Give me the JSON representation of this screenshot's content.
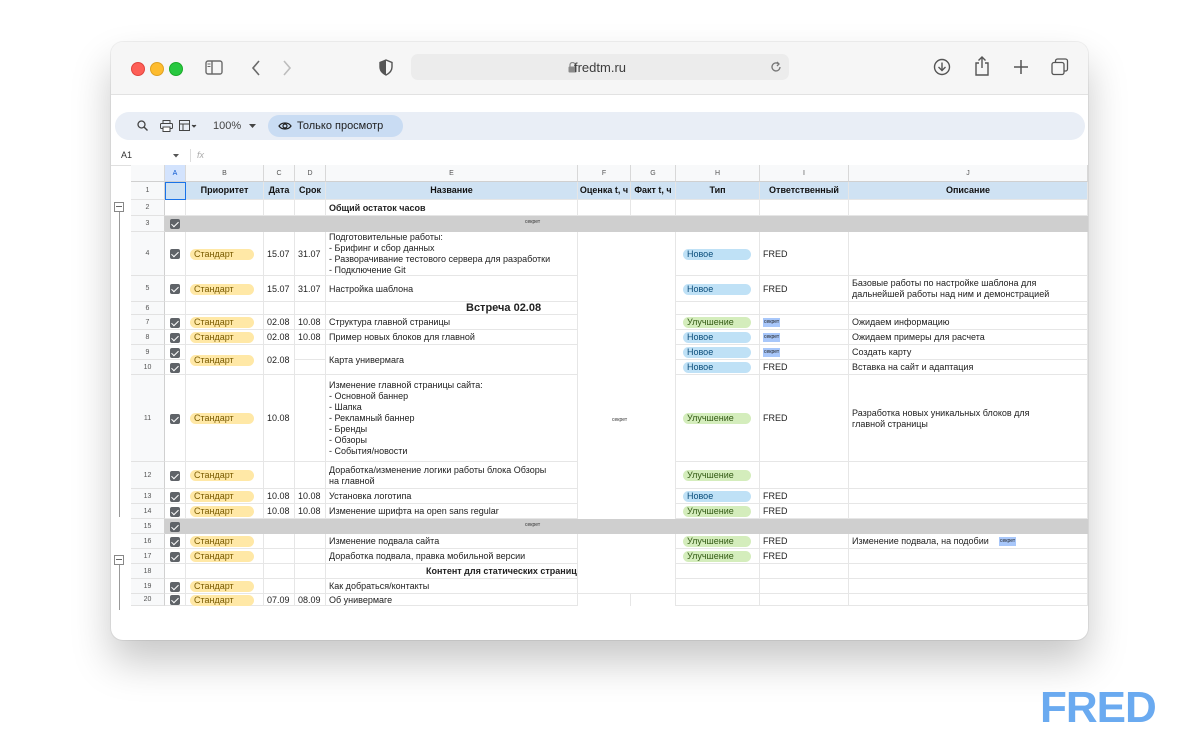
{
  "browser": {
    "url": "fredtm.ru"
  },
  "toolbar": {
    "zoom": "100%",
    "view_only": "Только просмотр"
  },
  "formula_bar": {
    "cell_ref": "A1",
    "fx": "fx"
  },
  "columns": [
    "A",
    "B",
    "C",
    "D",
    "E",
    "F",
    "G",
    "H",
    "I",
    "J"
  ],
  "header_row": {
    "b": "Приоритет",
    "c": "Дата",
    "d": "Срок",
    "e": "Название",
    "f": "Оценка t, ч",
    "g": "Факт t, ч",
    "h": "Тип",
    "i": "Ответственный",
    "j": "Описание"
  },
  "rows": [
    {
      "num": "1"
    },
    {
      "num": "2",
      "e": "Общий остаток часов"
    },
    {
      "num": "3",
      "secret": "секрет"
    },
    {
      "num": "4",
      "b": "Стандарт",
      "c": "15.07",
      "d": "31.07",
      "e": "Подготовительные работы:\n- Брифинг и сбор данных\n- Разворачивание тестового сервера для разработки\n- Подключение Git",
      "h": "Новое",
      "i": "FRED"
    },
    {
      "num": "5",
      "b": "Стандарт",
      "c": "15.07",
      "d": "31.07",
      "e": "Настройка шаблона",
      "h": "Новое",
      "i": "FRED",
      "j": "Базовые работы по настройке шаблона для\nдальнейшей работы над ним и демонстрацией"
    },
    {
      "num": "6",
      "e": "Встреча 02.08"
    },
    {
      "num": "7",
      "b": "Стандарт",
      "c": "02.08",
      "d": "10.08",
      "e": "Структура главной страницы",
      "h": "Улучшение",
      "i": "секрет",
      "j": "Ожидаем информацию"
    },
    {
      "num": "8",
      "b": "Стандарт",
      "c": "02.08",
      "d": "10.08",
      "e": "Пример новых блоков для главной",
      "h": "Новое",
      "i": "секрет",
      "j": "Ожидаем примеры для расчета"
    },
    {
      "num": "9",
      "h": "Новое",
      "i": "секрет",
      "j": "Создать карту"
    },
    {
      "num": "10",
      "h": "Новое",
      "i": "FRED",
      "j": "Вставка на сайт и адаптация"
    },
    {
      "num": "11",
      "b": "Стандарт",
      "c": "10.08",
      "e": "Изменение главной страницы сайта:\n- Основной баннер\n- Шапка\n- Рекламный баннер\n- Бренды\n- Обзоры\n- События/новости",
      "h": "Улучшение",
      "i": "FRED",
      "j": "Разработка новых уникальных блоков для\nглавной страницы"
    },
    {
      "num": "12",
      "b": "Стандарт",
      "e": "Доработка/изменение логики работы блока Обзоры\nна главной",
      "h": "Улучшение"
    },
    {
      "num": "13",
      "b": "Стандарт",
      "c": "10.08",
      "d": "10.08",
      "e": "Установка логотипа",
      "h": "Новое",
      "i": "FRED"
    },
    {
      "num": "14",
      "b": "Стандарт",
      "c": "10.08",
      "d": "10.08",
      "e": "Изменение шрифта на open sans regular",
      "h": "Улучшение",
      "i": "FRED"
    },
    {
      "num": "15",
      "secret": "секрет"
    },
    {
      "num": "16",
      "b": "Стандарт",
      "e": "Изменение подвала сайта",
      "h": "Улучшение",
      "i": "FRED",
      "j": "Изменение подвала, на подобии",
      "j_secret": "секрет"
    },
    {
      "num": "17",
      "b": "Стандарт",
      "e": "Доработка подвала, правка мобильной версии",
      "h": "Улучшение",
      "i": "FRED"
    },
    {
      "num": "18",
      "e": "Контент для статических страниц"
    },
    {
      "num": "19",
      "b": "Стандарт",
      "e": "Как добраться/контакты"
    },
    {
      "num": "20",
      "b": "Стандарт",
      "c": "07.09",
      "d": "08.09",
      "e": "Об универмаге"
    }
  ],
  "merged": {
    "b9": "Стандарт",
    "c9": "02.08",
    "e9": "Карта универмага",
    "fg_secret": "секрет"
  },
  "logo": "FRED"
}
